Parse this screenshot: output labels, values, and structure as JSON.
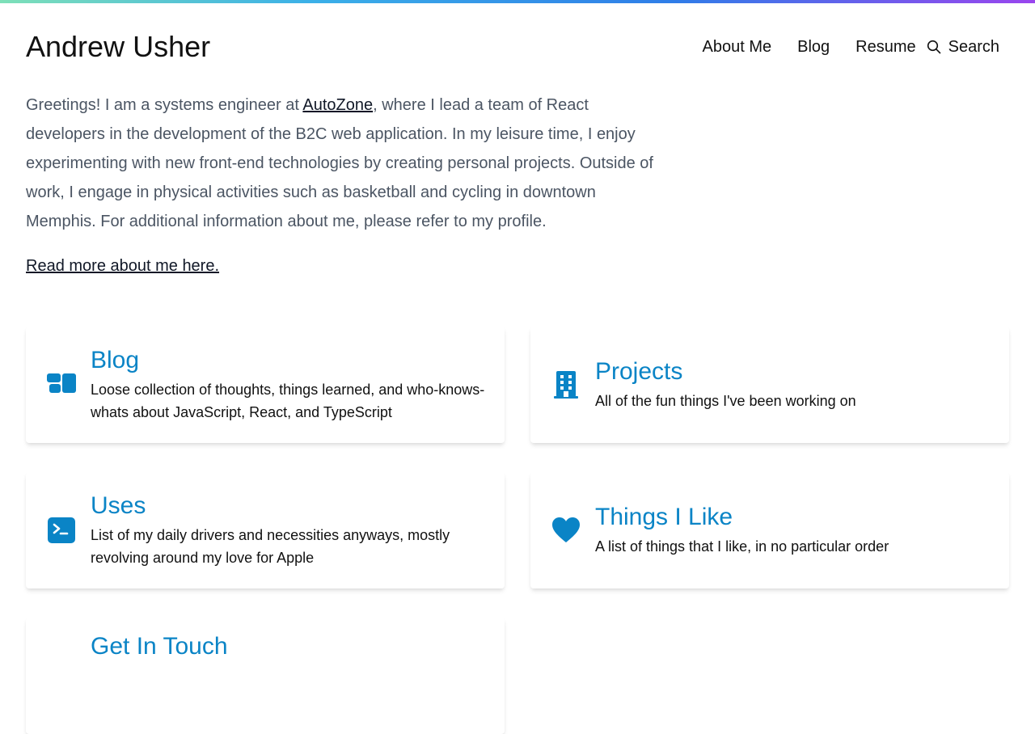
{
  "header": {
    "site_title": "Andrew Usher",
    "nav": {
      "about": "About Me",
      "blog": "Blog",
      "resume": "Resume",
      "search": "Search"
    }
  },
  "intro": {
    "text_before": "Greetings! I am a systems engineer at ",
    "company_link": "AutoZone",
    "text_after": ", where I lead a team of React developers in the development of the B2C web application. In my leisure time, I enjoy experimenting with new front-end technologies by creating personal projects. Outside of work, I engage in physical activities such as basketball and cycling in downtown Memphis. For additional information about me, please refer to my profile."
  },
  "read_more": "Read more about me here.",
  "cards": {
    "blog": {
      "title": "Blog",
      "description": "Loose collection of thoughts, things learned, and who-knows-whats about JavaScript, React, and TypeScript",
      "icon": "dashboard-icon"
    },
    "projects": {
      "title": "Projects",
      "description": "All of the fun things I've been working on",
      "icon": "building-icon"
    },
    "uses": {
      "title": "Uses",
      "description": "List of my daily drivers and necessities anyways, mostly revolving around my love for Apple",
      "icon": "terminal-icon"
    },
    "likes": {
      "title": "Things I Like",
      "description": "A list of things that I like, in no particular order",
      "icon": "heart-icon"
    },
    "contact": {
      "title": "Get In Touch"
    }
  },
  "colors": {
    "accent": "#0a84c6",
    "body_text": "#4b5563",
    "heading_text": "#111111"
  }
}
